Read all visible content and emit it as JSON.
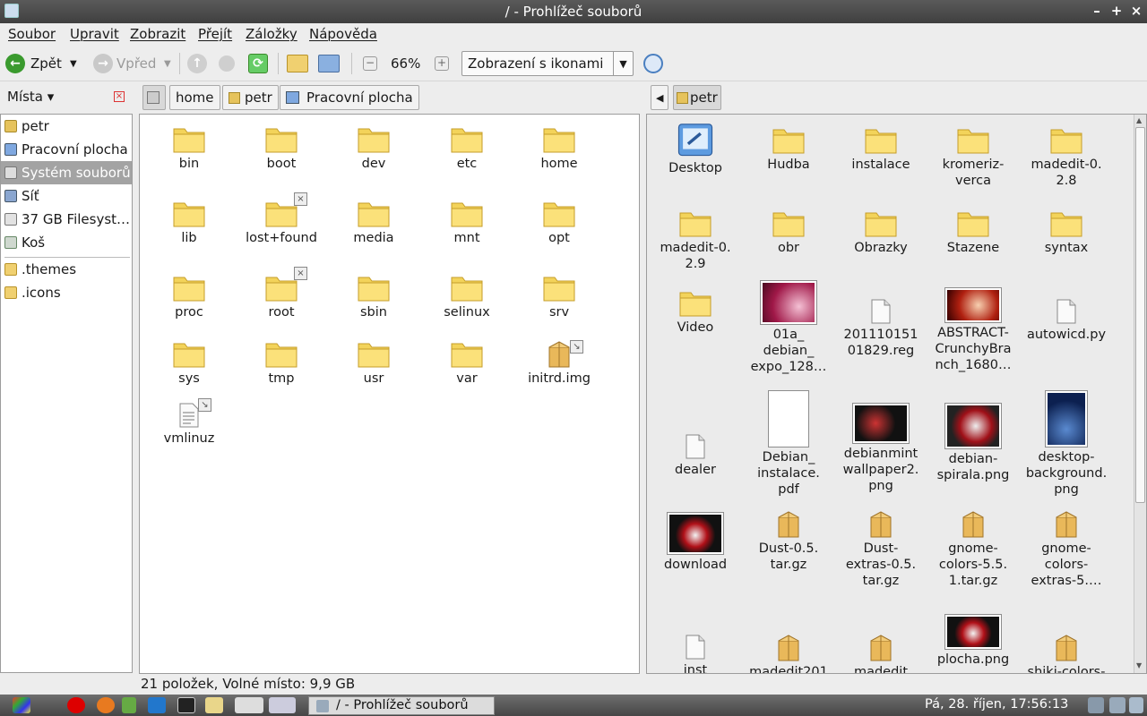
{
  "window": {
    "title": "/ - Prohlížeč souborů",
    "btn_min": "–",
    "btn_max": "+",
    "btn_close": "×"
  },
  "menu": [
    "Soubor",
    "Upravit",
    "Zobrazit",
    "Přejít",
    "Záložky",
    "Nápověda"
  ],
  "toolbar": {
    "back": "Zpět",
    "forward": "Vpřed",
    "zoom": "66%",
    "view_mode": "Zobrazení s ikonami"
  },
  "sidebar": {
    "header": "Místa",
    "items": [
      "petr",
      "Pracovní plocha",
      "Systém souborů",
      "Síť",
      "37 GB Filesyst…",
      "Koš"
    ],
    "bookmarks": [
      ".themes",
      ".icons"
    ]
  },
  "left_pane": {
    "crumbs": [
      "home",
      "petr",
      "Pracovní plocha"
    ],
    "items": [
      "bin",
      "boot",
      "dev",
      "etc",
      "home",
      "lib",
      "lost+found",
      "media",
      "mnt",
      "opt",
      "proc",
      "root",
      "sbin",
      "selinux",
      "srv",
      "sys",
      "tmp",
      "usr",
      "var",
      "initrd.img",
      "vmlinuz"
    ]
  },
  "right_pane": {
    "crumb": "petr",
    "items": [
      "Desktop",
      "Hudba",
      "instalace",
      "kromeriz-\nverca",
      "madedit-0.\n2.8",
      "madedit-0.\n2.9",
      "obr",
      "Obrazky",
      "Stazene",
      "syntax",
      "Video",
      "01a_\ndebian_\nexpo_128…",
      "201110151\n01829.reg",
      "ABSTRACT-\nCrunchyBra\nnch_1680…",
      "autowicd.py",
      "dealer",
      "Debian_\ninstalace.\npdf",
      "debianmint\nwallpaper2.\npng",
      "debian-\nspirala.png",
      "desktop-\nbackground.\npng",
      "download",
      "Dust-0.5.\ntar.gz",
      "Dust-\nextras-0.5.\ntar.gz",
      "gnome-\ncolors-5.5.\n1.tar.gz",
      "gnome-\ncolors-\nextras-5.…",
      "inst",
      "madedit201",
      "madedit",
      "plocha.png",
      "shiki-colors-"
    ]
  },
  "status": "21 položek, Volné místo: 9,9 GB",
  "taskbar": {
    "window_title": "/ - Prohlížeč souborů",
    "clock": "Pá, 28. říjen, 17:56:13"
  }
}
